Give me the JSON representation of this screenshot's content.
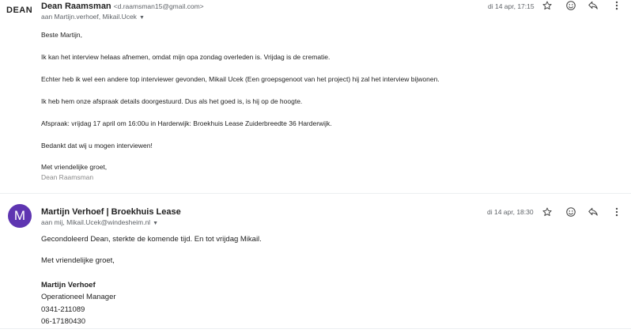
{
  "msg1": {
    "logo": "DEAN",
    "sender_name": "Dean Raamsman",
    "sender_email": "<d.raamsman15@gmail.com>",
    "recipients": "aan Martijn.verhoef, Mikail.Ucek",
    "date": "di 14 apr, 17:15",
    "body": [
      "Beste Martijn,",
      "Ik kan het interview helaas afnemen, omdat mijn opa zondag overleden is. Vrijdag is de crematie.",
      "Echter heb ik wel een andere top interviewer gevonden, Mikail Ucek (Een groepsgenoot van het project) hij zal het interview bijwonen.",
      "Ik heb hem onze afspraak details doorgestuurd. Dus als het goed is, is hij op de hoogte.",
      "Afspraak: vrijdag 17 april om 16:00u in Harderwijk: Broekhuis Lease Zuiderbreedte 36 Harderwijk.",
      "Bedankt dat wij u mogen interviewen!",
      "Met vriendelijke groet,",
      "Dean Raamsman"
    ]
  },
  "msg2": {
    "avatar_letter": "M",
    "sender_name": "Martijn Verhoef | Broekhuis Lease",
    "recipients": "aan mij, Mikail.Ucek@windesheim.nl",
    "date": "di 14 apr, 18:30",
    "body": [
      "Gecondoleerd Dean, sterkte de komende tijd. En tot vrijdag Mikail.",
      "Met vriendelijke groet,"
    ],
    "signature": {
      "name": "Martijn Verhoef",
      "title": "Operationeel Manager",
      "phone1": "0341-211089",
      "phone2": "06-17180430"
    }
  },
  "icons": {
    "star": "star-icon",
    "emoji": "emoji-icon",
    "reply": "reply-icon",
    "more": "more-vert-icon"
  },
  "colors": {
    "avatar_bg": "#5e35b1",
    "meta_text": "#5f6368"
  }
}
